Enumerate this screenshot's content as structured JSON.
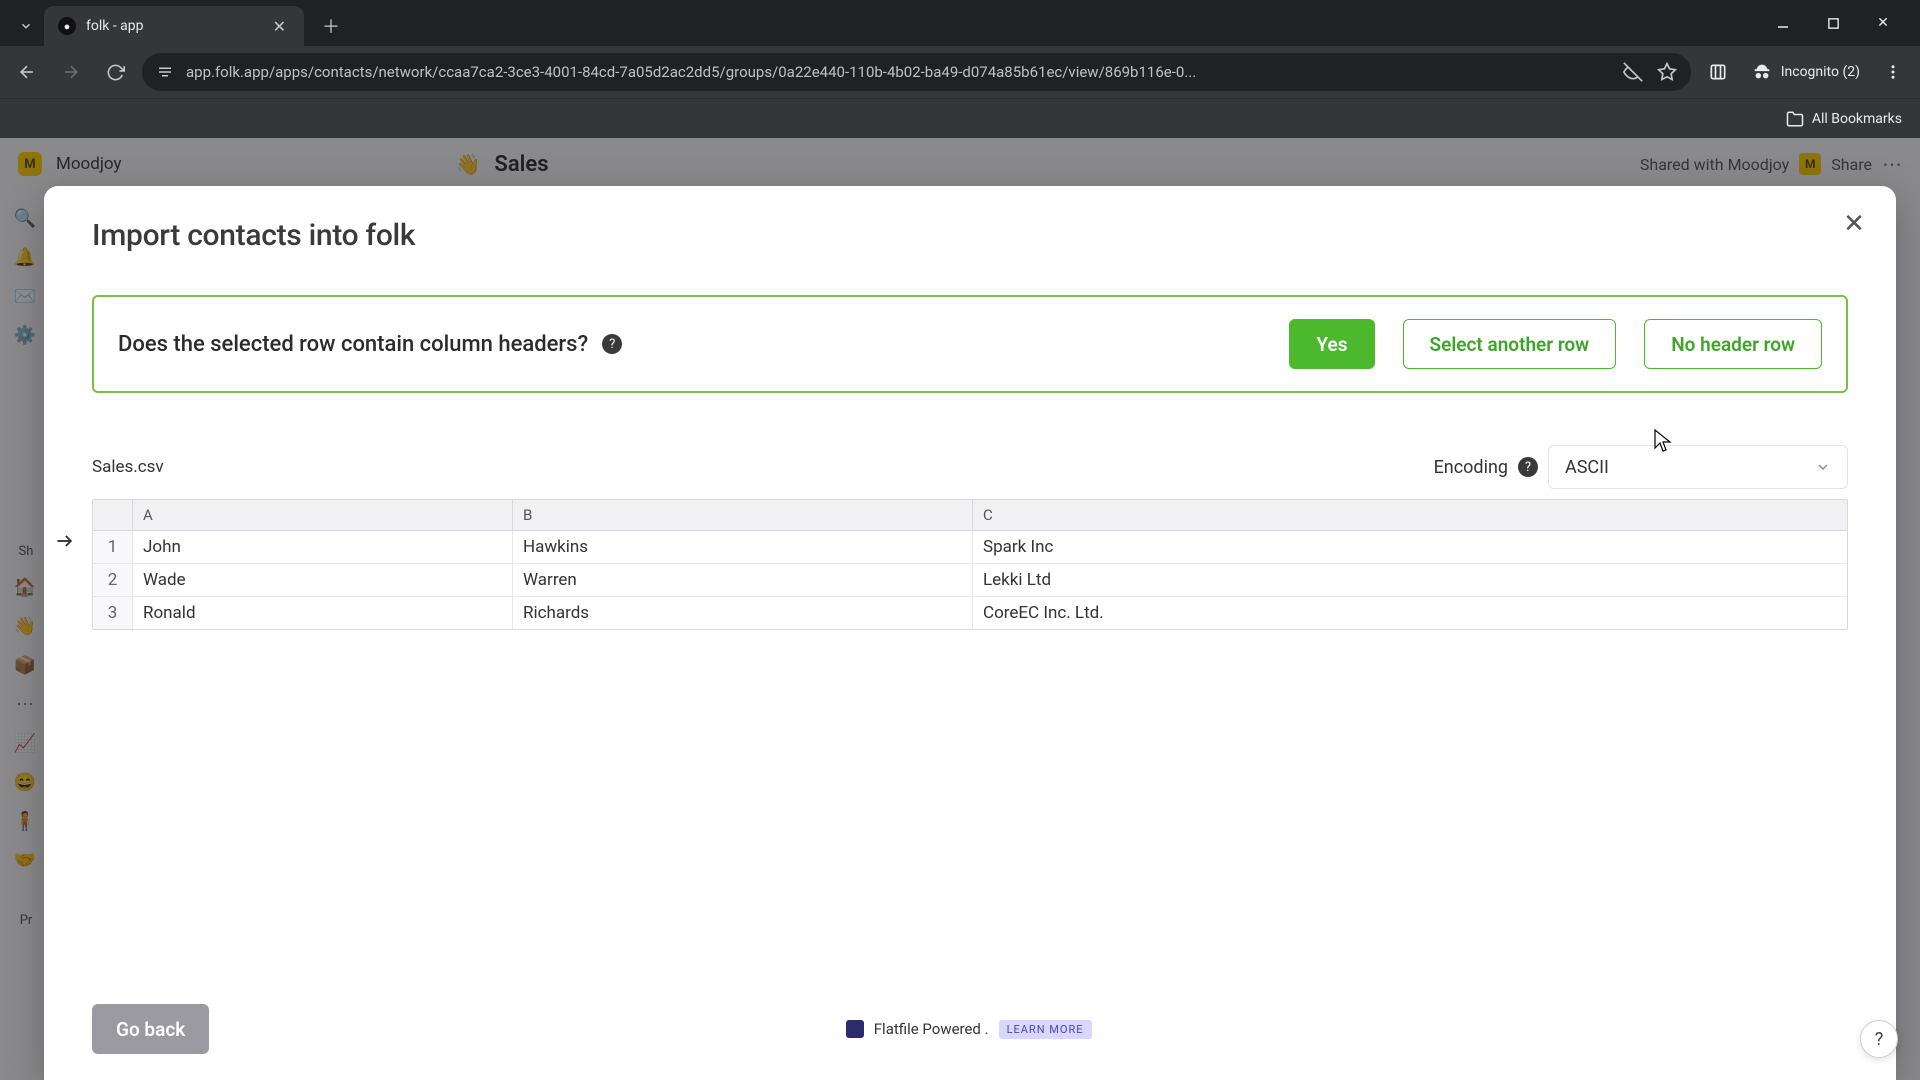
{
  "browser": {
    "tab_title": "folk - app",
    "url": "app.folk.app/apps/contacts/network/ccaa7ca2-3ce3-4001-84cd-7a05d2ac2dd5/groups/0a22e440-110b-4b02-ba49-d074a85b61ec/view/869b116e-0...",
    "incognito_label": "Incognito (2)",
    "all_bookmarks": "All Bookmarks"
  },
  "app": {
    "workspace_name": "Moodjoy",
    "workspace_initial": "M",
    "page_emoji": "👋",
    "page_title": "Sales",
    "shared_with": "Shared with Moodjoy",
    "share": "Share",
    "sidebar_sh_label": "Sh",
    "sidebar_pr_label": "Pr"
  },
  "modal": {
    "title": "Import contacts into folk",
    "question": "Does the selected row contain column headers?",
    "buttons": {
      "yes": "Yes",
      "select_another": "Select another row",
      "no_header": "No header row"
    },
    "file_name": "Sales.csv",
    "encoding_label": "Encoding",
    "encoding_value": "ASCII",
    "columns": [
      "A",
      "B",
      "C"
    ],
    "selected_row_index": 1,
    "rows": [
      {
        "n": "1",
        "cells": [
          "John",
          "Hawkins",
          "Spark Inc"
        ]
      },
      {
        "n": "2",
        "cells": [
          "Wade",
          "Warren",
          "Lekki Ltd"
        ]
      },
      {
        "n": "3",
        "cells": [
          "Ronald",
          "Richards",
          "CoreEC Inc. Ltd."
        ]
      }
    ],
    "go_back": "Go back",
    "powered_text": "Flatfile Powered .",
    "learn_more": "LEARN MORE"
  }
}
